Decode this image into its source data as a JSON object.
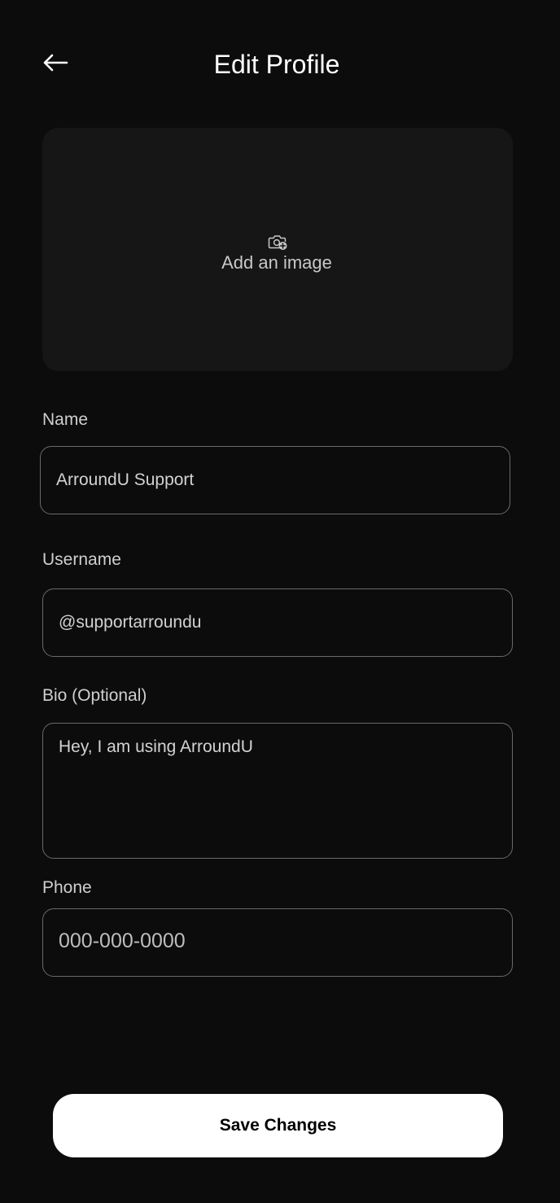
{
  "header": {
    "back_icon": "arrow-left-icon",
    "title": "Edit Profile"
  },
  "image_picker": {
    "icon": "camera-add-icon",
    "label": "Add an image"
  },
  "form": {
    "name": {
      "label": "Name",
      "value": "ArroundU Support"
    },
    "username": {
      "label": "Username",
      "value": "@supportarroundu"
    },
    "bio": {
      "label": "Bio (Optional)",
      "value": "Hey, I am using ArroundU"
    },
    "phone": {
      "label": "Phone",
      "value": "",
      "placeholder": "000-000-0000"
    }
  },
  "actions": {
    "save_label": "Save Changes"
  },
  "colors": {
    "background": "#0c0c0c",
    "card": "#161616",
    "field_border": "#6a6a6a",
    "text": "#ffffff",
    "button_bg": "#ffffff",
    "button_text": "#000000"
  }
}
